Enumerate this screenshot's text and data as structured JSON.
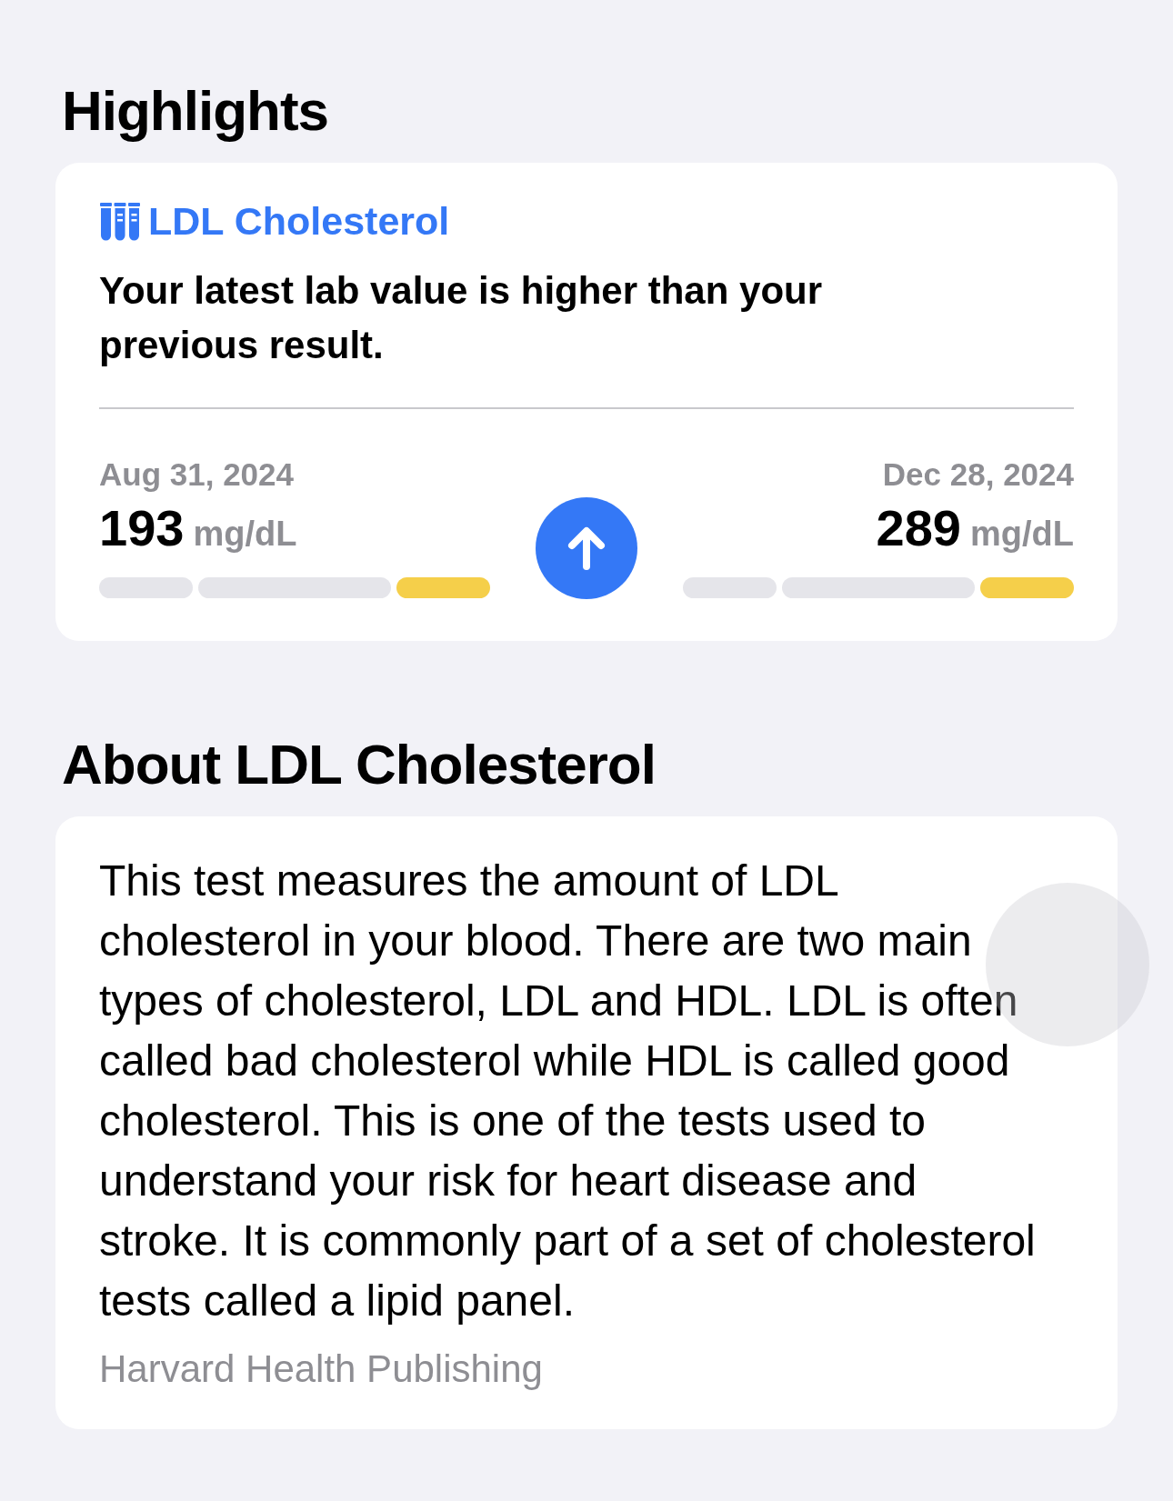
{
  "highlights": {
    "title": "Highlights",
    "card": {
      "category": "LDL Cholesterol",
      "message": "Your latest lab value is higher than your previous result.",
      "increased": true,
      "previous": {
        "date": "Aug 31, 2024",
        "value": "193",
        "unit": "mg/dL",
        "segments": [
          {
            "active": false
          },
          {
            "active": false
          },
          {
            "active": true
          }
        ]
      },
      "latest": {
        "date": "Dec 28, 2024",
        "value": "289",
        "unit": "mg/dL",
        "segments": [
          {
            "active": false
          },
          {
            "active": false
          },
          {
            "active": true
          }
        ]
      }
    }
  },
  "about": {
    "title": "About LDL Cholesterol",
    "text": "This test measures the amount of LDL cholesterol in your blood. There are two main types of cholesterol, LDL and HDL. LDL is often called bad cholesterol while HDL is called good cholesterol. This is one of the tests used to understand your risk for heart disease and stroke. It is commonly part of a set of cholesterol tests called a lipid panel.",
    "source": "Harvard Health Publishing"
  }
}
